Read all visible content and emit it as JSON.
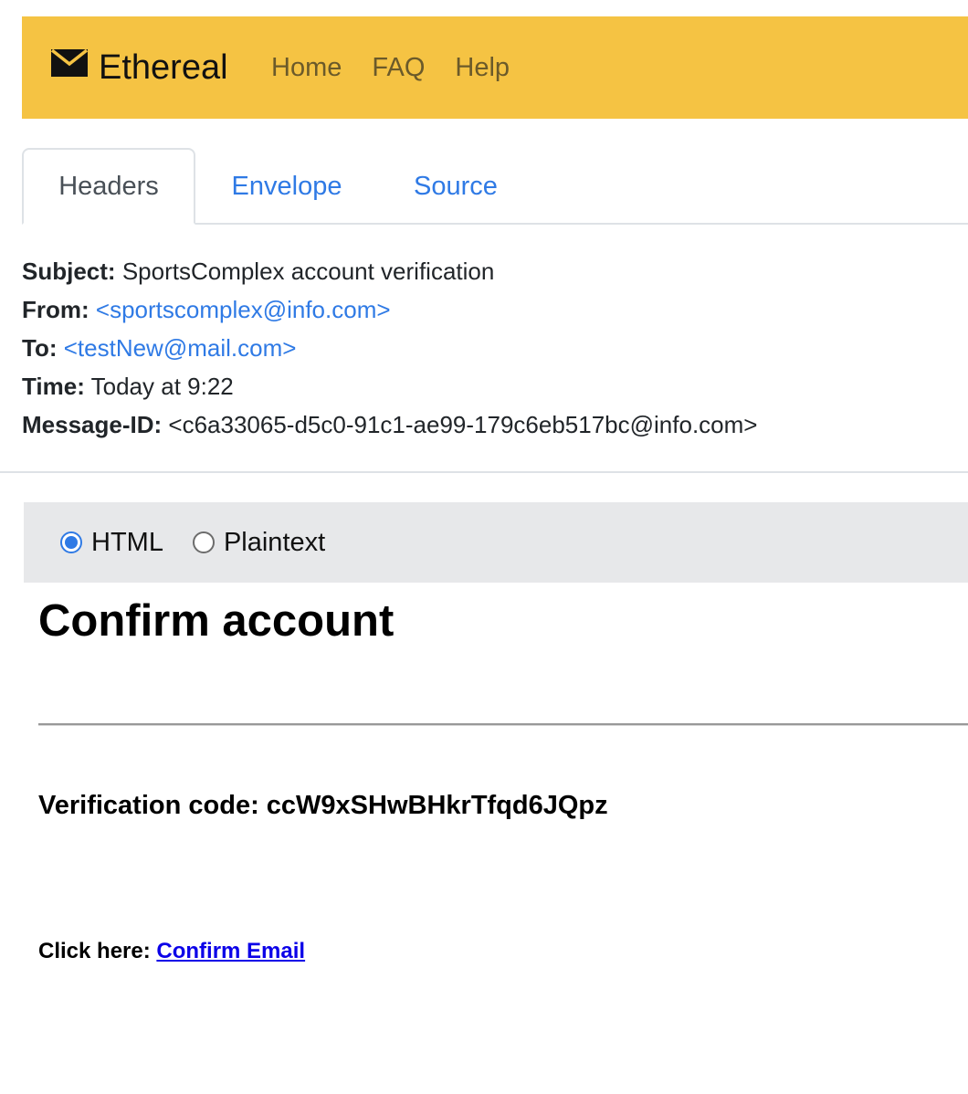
{
  "navbar": {
    "brand": "Ethereal",
    "brand_icon": "envelope-icon",
    "links": [
      "Home",
      "FAQ",
      "Help"
    ],
    "background": "#f5c343"
  },
  "tabs": {
    "items": [
      "Headers",
      "Envelope",
      "Source"
    ],
    "active": "Headers"
  },
  "headers": {
    "subject_label": "Subject:",
    "subject": "SportsComplex account verification",
    "from_label": "From:",
    "from": "<sportscomplex@info.com>",
    "to_label": "To:",
    "to": "<testNew@mail.com>",
    "time_label": "Time:",
    "time": "Today at 9:22",
    "message_id_label": "Message-ID:",
    "message_id": "<c6a33065-d5c0-91c1-ae99-179c6eb517bc@info.com>"
  },
  "view": {
    "options": [
      "HTML",
      "Plaintext"
    ],
    "selected": "HTML"
  },
  "email": {
    "title": "Confirm account",
    "verification_text": "Verification code: ccW9xSHwBHkrTfqd6JQpz",
    "click_prefix": "Click here:",
    "confirm_link": "Confirm Email"
  },
  "colors": {
    "accent": "#2f7ae5",
    "link": "#0b00e8"
  }
}
